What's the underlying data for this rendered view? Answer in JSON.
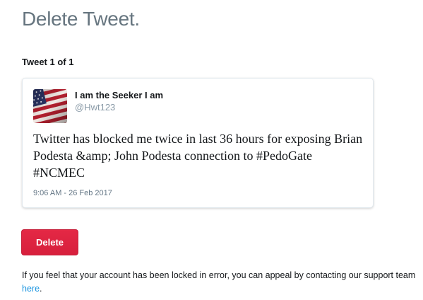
{
  "page": {
    "title": "Delete Tweet."
  },
  "tweet_counter": "Tweet 1 of 1",
  "tweet": {
    "author_name": "I am the Seeker I am",
    "author_handle": "@Hwt123",
    "avatar_icon": "american-flag-avatar",
    "text": "Twitter has blocked me twice in last 36 hours for exposing Brian Podesta &amp; John Podesta connection to #PedoGate #NCMEC",
    "timestamp": "9:06 AM - 26 Feb 2017"
  },
  "actions": {
    "delete_label": "Delete"
  },
  "appeal": {
    "text_before": "If you feel that your account has been locked in error, you can appeal by contacting our support team ",
    "link_text": "here",
    "text_after": "."
  },
  "colors": {
    "title": "#66757f",
    "delete_button": "#e0245e",
    "link": "#1b95e0",
    "handle": "#8899a6"
  }
}
